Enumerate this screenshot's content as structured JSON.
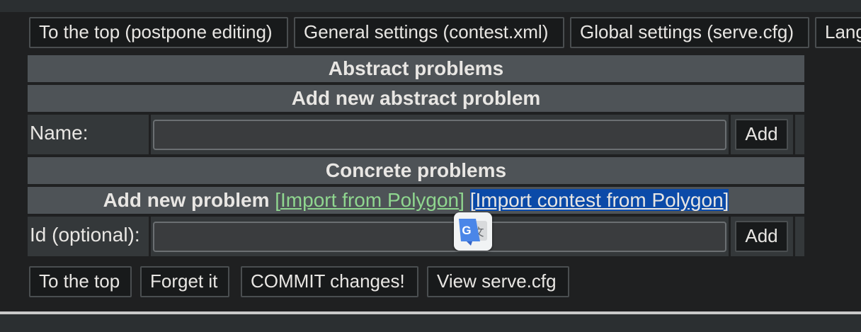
{
  "top_nav": {
    "buttons": [
      "To the top (postpone editing)",
      "General settings (contest.xml)",
      "Global settings (serve.cfg)",
      "Lang"
    ]
  },
  "abstract": {
    "title": "Abstract problems",
    "add_title": "Add new abstract problem",
    "name_label": "Name:",
    "name_value": "",
    "add_button": "Add"
  },
  "concrete": {
    "title": "Concrete problems",
    "add_title": "Add new problem",
    "open_bracket": "[",
    "import_link": "Import from Polygon",
    "close_bracket": "]",
    "open_bracket2": "[",
    "import_contest_link": "Import contest from Polygon",
    "close_bracket2": "]",
    "id_label": "Id (optional):",
    "id_value": "",
    "add_button": "Add"
  },
  "bottom_nav": {
    "buttons": [
      "To the top",
      "Forget it",
      "COMMIT changes!",
      "View serve.cfg"
    ]
  },
  "overlay": {
    "translate_icon": "google-translate-icon"
  },
  "colors": {
    "background": "#1f2021",
    "header": "#4e5357",
    "link": "#8fd68f",
    "selection": "#0b4aa8"
  }
}
